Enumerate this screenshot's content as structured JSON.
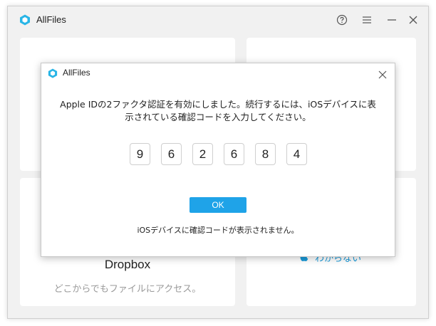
{
  "window": {
    "title": "AllFiles"
  },
  "cards": {
    "dropbox": {
      "title": "Dropbox",
      "subtitle": "どこからでもファイルにアクセス。"
    },
    "right_bottom": {
      "link": "わからない"
    }
  },
  "dialog": {
    "title": "AllFiles",
    "message_line1": "Apple IDの2ファクタ認証を有効にしました。続行するには、iOSデバイスに表",
    "message_line2": "示されている確認コードを入力してください。",
    "code_digits": [
      "9",
      "6",
      "2",
      "6",
      "8",
      "4"
    ],
    "ok_label": "OK",
    "help_text": "iOSデバイスに確認コードが表示されません。"
  },
  "colors": {
    "accent": "#1fa3e8",
    "logo": "#28b5e6",
    "window_bg": "#f1f1f1"
  },
  "icons": {
    "help": "help-circle-icon",
    "menu": "menu-icon",
    "minimize": "minimize-icon",
    "close": "close-icon",
    "apple": "apple-icon"
  }
}
